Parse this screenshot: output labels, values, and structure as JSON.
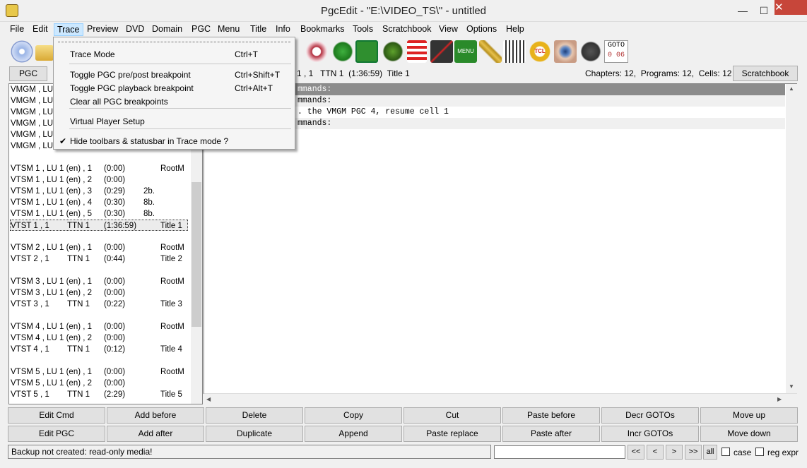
{
  "window": {
    "title": "PgcEdit -   \"E:\\VIDEO_TS\\\" - untitled",
    "minimize": "—",
    "maximize": "☐",
    "close": "✕"
  },
  "menubar": [
    "File",
    "Edit",
    "Trace",
    "Preview",
    "DVD",
    "Domain",
    "PGC",
    "Menu",
    "Title",
    "Info",
    "Bookmarks",
    "Tools",
    "Scratchbook",
    "View",
    "Options",
    "Help"
  ],
  "toolbar": {
    "goto_label": "GOTO",
    "goto_value": "0 06",
    "menu_icon_text": "MENU",
    "tcl_icon_text": "TCL"
  },
  "infobar": {
    "pgc_tab": "PGC",
    "location": "1 , 1   TTN 1  (1:36:59)  Title 1",
    "counts": "Chapters: 12,  Programs: 12,  Cells: 12",
    "scratchbook": "Scratchbook"
  },
  "pgc_list": [
    {
      "a": "VMGM , LU",
      "b": "",
      "c": "",
      "d": ""
    },
    {
      "a": "VMGM , LU",
      "b": "",
      "c": "",
      "d": ""
    },
    {
      "a": "VMGM , LU",
      "b": "",
      "c": "",
      "d": ""
    },
    {
      "a": "VMGM , LU",
      "b": "",
      "c": "",
      "d": ""
    },
    {
      "a": "VMGM , LU",
      "b": "",
      "c": "",
      "d": ""
    },
    {
      "a": "VMGM , LU",
      "b": "",
      "c": "",
      "d": ""
    },
    {
      "a": "",
      "b": "",
      "c": "",
      "d": ""
    },
    {
      "a": "VTSM 1 , LU 1 (en) , 1",
      "b": "(0:00)",
      "c": "",
      "d": "RootM"
    },
    {
      "a": "VTSM 1 , LU 1 (en) , 2",
      "b": "(0:00)",
      "c": "",
      "d": ""
    },
    {
      "a": "VTSM 1 , LU 1 (en) , 3",
      "b": "(0:29)",
      "c": "2b.",
      "d": ""
    },
    {
      "a": "VTSM 1 , LU 1 (en) , 4",
      "b": "(0:30)",
      "c": "8b.",
      "d": ""
    },
    {
      "a": "VTSM 1 , LU 1 (en) , 5",
      "b": "(0:30)",
      "c": "8b.",
      "d": ""
    },
    {
      "a": "VTST 1 , 1        TTN 1",
      "b": "(1:36:59)",
      "c": "",
      "d": "Title 1",
      "sel": true
    },
    {
      "a": "",
      "b": "",
      "c": "",
      "d": ""
    },
    {
      "a": "VTSM 2 , LU 1 (en) , 1",
      "b": "(0:00)",
      "c": "",
      "d": "RootM"
    },
    {
      "a": "VTST 2 , 1        TTN 1",
      "b": "(0:44)",
      "c": "",
      "d": "Title 2"
    },
    {
      "a": "",
      "b": "",
      "c": "",
      "d": ""
    },
    {
      "a": "VTSM 3 , LU 1 (en) , 1",
      "b": "(0:00)",
      "c": "",
      "d": "RootM"
    },
    {
      "a": "VTSM 3 , LU 1 (en) , 2",
      "b": "(0:00)",
      "c": "",
      "d": ""
    },
    {
      "a": "VTST 3 , 1        TTN 1",
      "b": "(0:22)",
      "c": "",
      "d": "Title 3"
    },
    {
      "a": "",
      "b": "",
      "c": "",
      "d": ""
    },
    {
      "a": "VTSM 4 , LU 1 (en) , 1",
      "b": "(0:00)",
      "c": "",
      "d": "RootM"
    },
    {
      "a": "VTSM 4 , LU 1 (en) , 2",
      "b": "(0:00)",
      "c": "",
      "d": ""
    },
    {
      "a": "VTST 4 , 1        TTN 1",
      "b": "(0:12)",
      "c": "",
      "d": "Title 4"
    },
    {
      "a": "",
      "b": "",
      "c": "",
      "d": ""
    },
    {
      "a": "VTSM 5 , LU 1 (en) , 1",
      "b": "(0:00)",
      "c": "",
      "d": "RootM"
    },
    {
      "a": "VTSM 5 , LU 1 (en) , 2",
      "b": "(0:00)",
      "c": "",
      "d": ""
    },
    {
      "a": "VTST 5 , 1        TTN 1",
      "b": "(2:29)",
      "c": "",
      "d": "Title 5"
    }
  ],
  "commands": [
    {
      "text": "mmands:",
      "style": "hdr"
    },
    {
      "text": "mmands:",
      "style": "sub"
    },
    {
      "text": ". the VMGM PGC 4, resume cell 1",
      "style": "plain"
    },
    {
      "text": "mmands:",
      "style": "sub"
    }
  ],
  "buttons_row1": [
    "Edit Cmd",
    "Add before",
    "Delete",
    "Copy",
    "Cut",
    "Paste before",
    "Decr GOTOs",
    "Move up"
  ],
  "buttons_row2": [
    "Edit PGC",
    "Add after",
    "Duplicate",
    "Append",
    "Paste replace",
    "Paste after",
    "Incr GOTOs",
    "Move down"
  ],
  "statusbar": {
    "message": "Backup not created: read-only media!",
    "search_value": "",
    "nav": [
      "<<",
      "<",
      ">",
      ">>",
      "all"
    ],
    "case_label": "case",
    "regex_label": "reg expr"
  },
  "trace_menu": [
    {
      "label": "Trace Mode",
      "shortcut": "Ctrl+T",
      "checked": false
    },
    {
      "label": "Toggle PGC pre/post breakpoint",
      "shortcut": "Ctrl+Shift+T",
      "checked": false
    },
    {
      "label": "Toggle PGC playback breakpoint",
      "shortcut": "Ctrl+Alt+T",
      "checked": false
    },
    {
      "label": "Clear all PGC breakpoints",
      "shortcut": "",
      "checked": false
    },
    {
      "label": "Virtual Player Setup",
      "shortcut": "",
      "checked": false
    },
    {
      "label": "Hide toolbars & statusbar in Trace mode ?",
      "shortcut": "",
      "checked": true
    }
  ],
  "check_glyph": "✔"
}
